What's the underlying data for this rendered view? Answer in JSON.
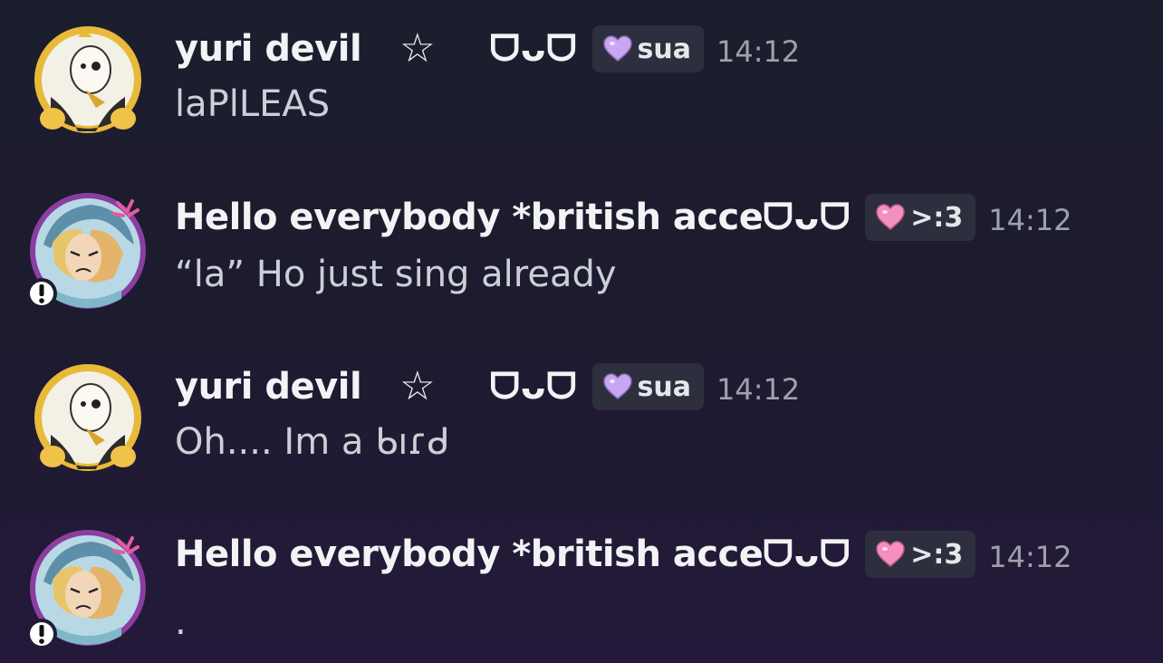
{
  "colors": {
    "username": "#f2f3f5",
    "message_text": "#cdcfd6",
    "timestamp": "#9ea1ac",
    "tag_bg": "#2e2f3e",
    "heart_purple": "#c9a6f2",
    "heart_pink": "#f48fbf"
  },
  "messages": [
    {
      "username": "yuri devil",
      "star": "☆",
      "face": "ᗜᴗᗜ",
      "tag_icon": "purple-heart-icon",
      "tag_label": "sua",
      "timestamp": "14:12",
      "text": "laPlLEAS",
      "avatar_icon": "skull-face-avatar-icon"
    },
    {
      "username": "Hello everybody *british acce",
      "face": "ᗜᴗᗜ",
      "tag_icon": "pink-heart-icon",
      "tag_label": ">:3",
      "timestamp": "14:12",
      "text": "“la” Ho just sing already",
      "avatar_icon": "angry-character-avatar-icon",
      "status_icon": "exclamation-status-icon"
    },
    {
      "username": "yuri devil",
      "star": "☆",
      "face": "ᗜᴗᗜ",
      "tag_icon": "purple-heart-icon",
      "tag_label": "sua",
      "timestamp": "14:12",
      "text": "Oh.... Im a ᑲıɾᑯ",
      "avatar_icon": "skull-face-avatar-icon"
    },
    {
      "username": "Hello everybody *british acce",
      "face": "ᗜᴗᗜ",
      "tag_icon": "pink-heart-icon",
      "tag_label": ">:3",
      "timestamp": "14:12",
      "text": ".",
      "avatar_icon": "angry-character-avatar-icon",
      "status_icon": "exclamation-status-icon"
    }
  ]
}
